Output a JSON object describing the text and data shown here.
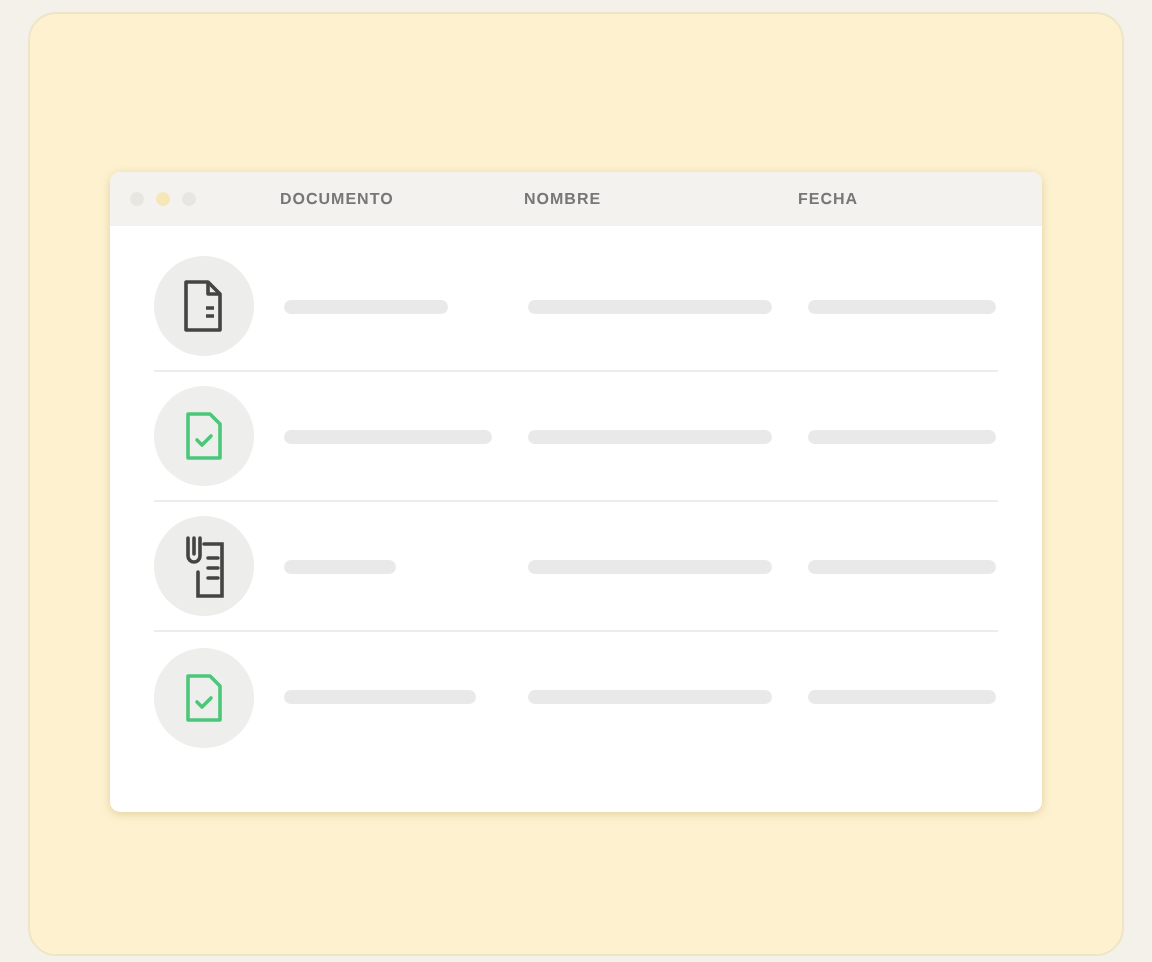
{
  "table": {
    "columns": [
      "DOCUMENTO",
      "NOMBRE",
      "FECHA"
    ],
    "rows": [
      {
        "kind": "document"
      },
      {
        "kind": "approved"
      },
      {
        "kind": "attachment"
      },
      {
        "kind": "approved"
      }
    ]
  }
}
